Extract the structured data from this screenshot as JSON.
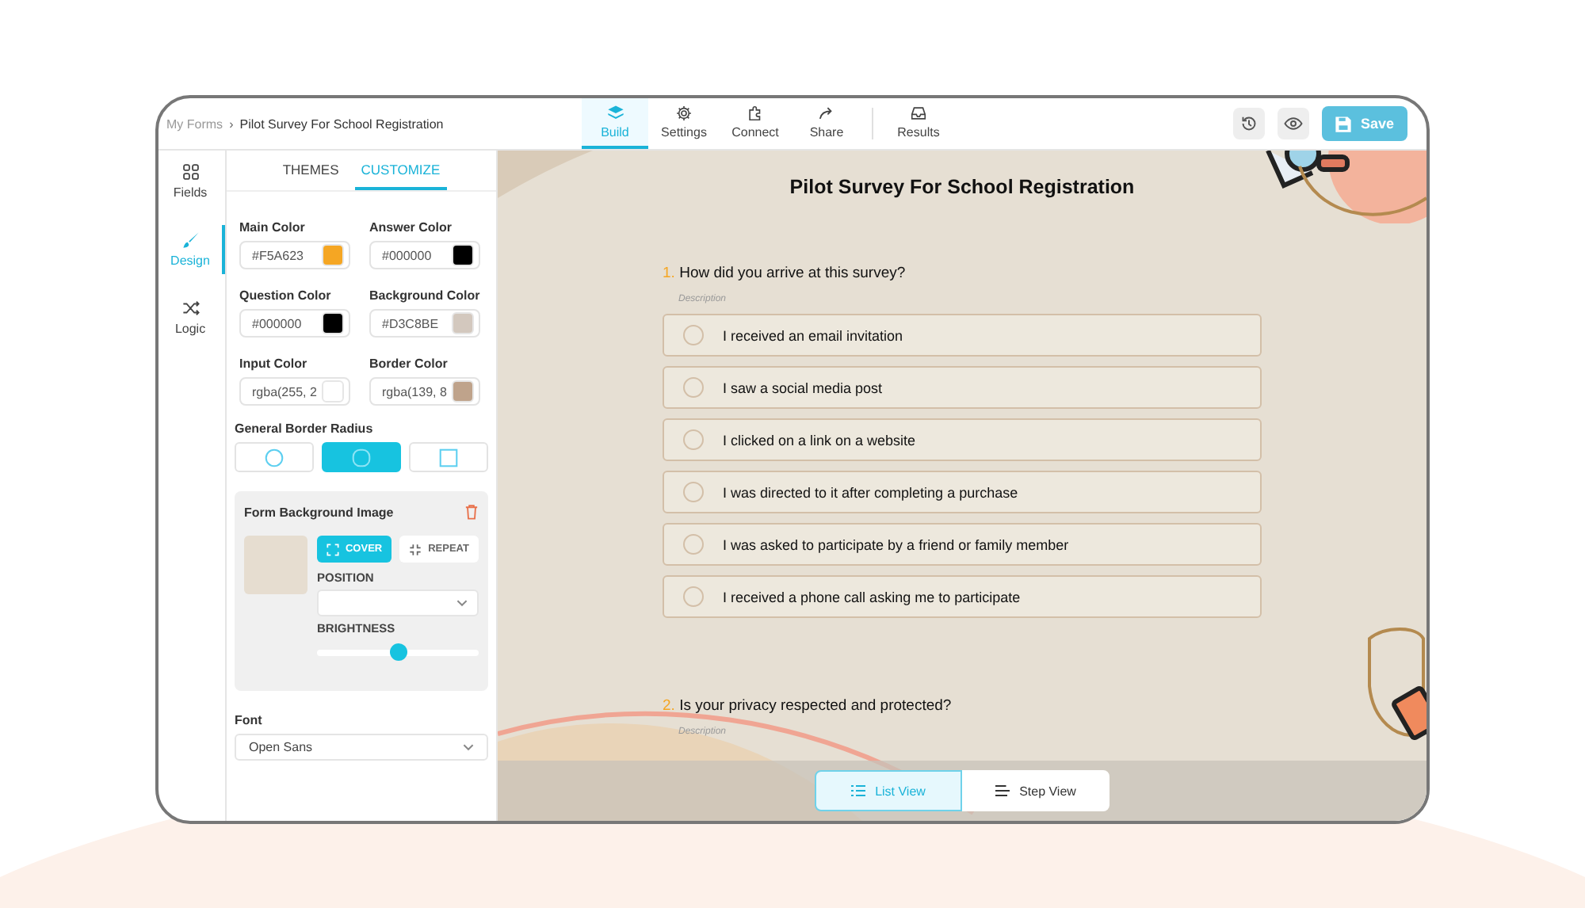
{
  "breadcrumb": {
    "parent": "My Forms",
    "separator": "›",
    "current": "Pilot Survey For School Registration"
  },
  "nav_tabs": [
    {
      "label": "Build",
      "selected": true
    },
    {
      "label": "Settings",
      "selected": false
    },
    {
      "label": "Connect",
      "selected": false
    },
    {
      "label": "Share",
      "selected": false
    },
    {
      "label": "Results",
      "selected": false
    }
  ],
  "save_button": "Save",
  "sidebar": [
    {
      "label": "Fields",
      "selected": false
    },
    {
      "label": "Design",
      "selected": true
    },
    {
      "label": "Logic",
      "selected": false
    }
  ],
  "panel_tabs": [
    {
      "label": "THEMES",
      "selected": false
    },
    {
      "label": "CUSTOMIZE",
      "selected": true
    }
  ],
  "color_fields": [
    {
      "label": "Main Color",
      "value": "#F5A623",
      "color": "#f5a623"
    },
    {
      "label": "Answer Color",
      "value": "#000000",
      "color": "#000000"
    },
    {
      "label": "Question Color",
      "value": "#000000",
      "color": "#000000"
    },
    {
      "label": "Background Color",
      "value": "#D3C8BE",
      "color": "#d3c8be"
    },
    {
      "label": "Input Color",
      "value": "rgba(255, 2",
      "color": "#ffffff"
    },
    {
      "label": "Border Color",
      "value": "rgba(139, 8",
      "color": "#bfa38b"
    }
  ],
  "border_radius": {
    "label": "General Border Radius",
    "options": [
      {
        "kind": "circle",
        "selected": false
      },
      {
        "kind": "rounded",
        "selected": true
      },
      {
        "kind": "square",
        "selected": false
      }
    ]
  },
  "background_image": {
    "title": "Form Background Image",
    "fit_options": [
      {
        "label": "COVER",
        "selected": true
      },
      {
        "label": "REPEAT",
        "selected": false
      }
    ],
    "position_label": "POSITION",
    "brightness_label": "BRIGHTNESS",
    "level": 0.5
  },
  "font": {
    "label": "Font",
    "value": "Open Sans"
  },
  "form": {
    "title": "Pilot Survey For School Registration",
    "questions": [
      {
        "number": "1.",
        "text": "How did you arrive at this survey?",
        "description": "Description",
        "options": [
          {
            "label": "I received an email invitation",
            "selected": false
          },
          {
            "label": "I saw a social media post",
            "selected": false
          },
          {
            "label": "I clicked on a link on a website",
            "selected": false
          },
          {
            "label": "I was directed to it after completing a purchase",
            "selected": false
          },
          {
            "label": "I was asked to participate by a friend or family member",
            "selected": false
          },
          {
            "label": "I received a phone call asking me to participate",
            "selected": false
          }
        ]
      },
      {
        "number": "2.",
        "text": "Is your privacy respected and protected?",
        "description": "Description"
      }
    ]
  },
  "view_toggle": [
    {
      "label": "List View",
      "selected": true
    },
    {
      "label": "Step View",
      "selected": false
    }
  ]
}
